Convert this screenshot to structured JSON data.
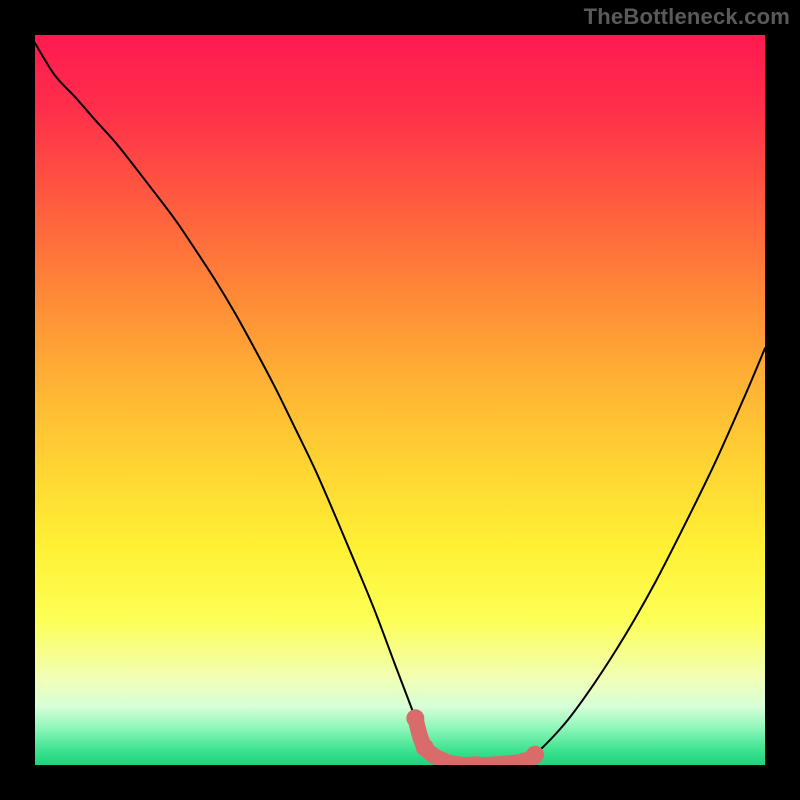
{
  "watermark": "TheBottleneck.com",
  "colors": {
    "background": "#000000",
    "curve": "#000000",
    "marker_stroke": "#d96b6b",
    "marker_fill": "#d96b6b"
  },
  "chart_data": {
    "type": "line",
    "title": "",
    "xlabel": "",
    "ylabel": "",
    "xlim": [
      0,
      100
    ],
    "ylim": [
      0,
      100
    ],
    "series": [
      {
        "name": "left-curve",
        "x": [
          0.0,
          2.7,
          5.5,
          8.2,
          11.0,
          13.7,
          16.4,
          19.2,
          21.9,
          24.7,
          27.4,
          30.1,
          32.9,
          35.6,
          38.4,
          41.1,
          43.8,
          46.6,
          49.3,
          52.1,
          53.4,
          56.2,
          58.9,
          60.3,
          61.6
        ],
        "y": [
          98.9,
          94.5,
          91.5,
          88.4,
          85.3,
          81.9,
          78.4,
          74.7,
          70.7,
          66.4,
          61.9,
          57.0,
          51.7,
          46.2,
          40.4,
          34.2,
          27.8,
          21.0,
          13.8,
          6.4,
          2.4,
          0.5,
          0.0,
          0.1,
          0.0
        ]
      },
      {
        "name": "right-curve",
        "x": [
          61.6,
          64.4,
          67.1,
          68.5,
          72.6,
          76.7,
          80.8,
          84.9,
          89.0,
          93.2,
          97.3,
          100.0
        ],
        "y": [
          0.0,
          0.2,
          0.5,
          1.4,
          5.7,
          11.3,
          17.7,
          24.9,
          32.9,
          41.5,
          50.7,
          57.1
        ]
      }
    ],
    "markers": {
      "name": "flat-region-markers",
      "x": [
        52.1,
        53.4,
        56.2,
        58.9,
        60.3,
        61.6,
        64.4,
        67.1,
        68.5
      ],
      "y": [
        6.4,
        2.4,
        0.5,
        0.0,
        0.1,
        0.0,
        0.2,
        0.5,
        1.4
      ]
    },
    "annotations": []
  }
}
